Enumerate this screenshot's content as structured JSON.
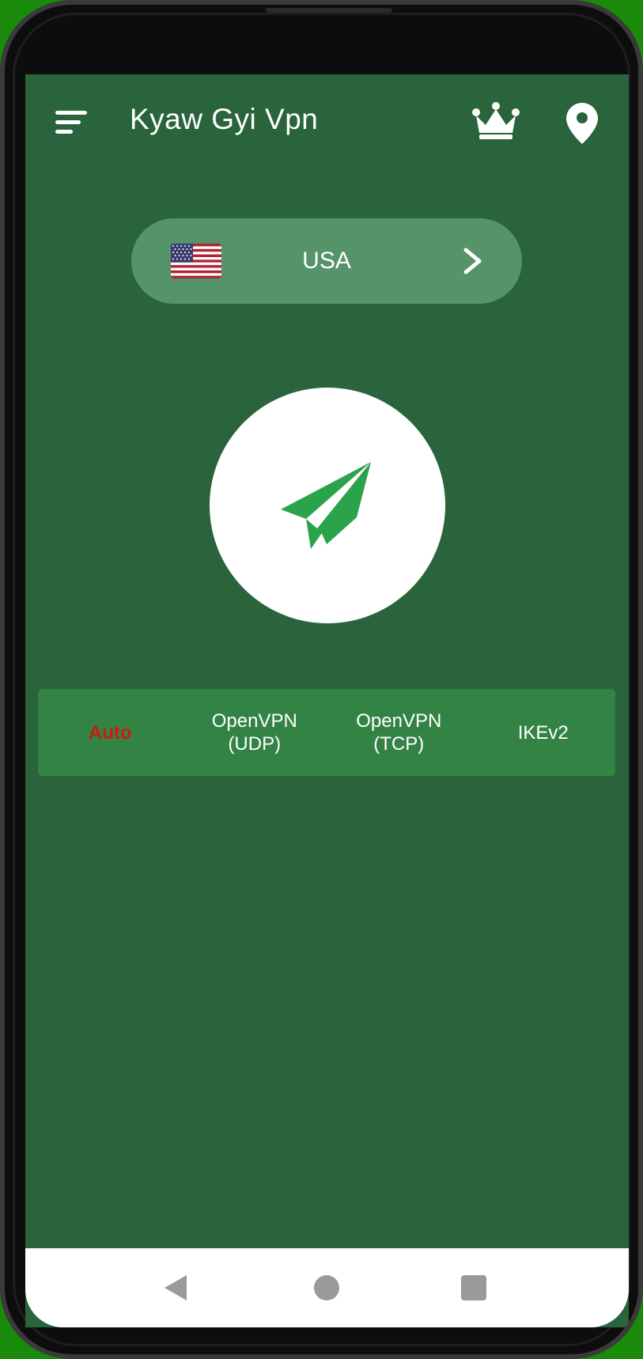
{
  "app": {
    "title": "Kyaw Gyi Vpn"
  },
  "header": {
    "menu_icon": "menu-icon",
    "premium_icon": "crown-icon",
    "location_icon": "location-pin-icon"
  },
  "server": {
    "country": "USA",
    "flag_icon": "us-flag-icon",
    "chevron_icon": "chevron-right-icon"
  },
  "connect": {
    "icon": "paper-plane-icon"
  },
  "protocols": [
    {
      "label": "Auto",
      "selected": true
    },
    {
      "label": "OpenVPN (UDP)",
      "selected": false
    },
    {
      "label": "OpenVPN (TCP)",
      "selected": false
    },
    {
      "label": "IKEv2",
      "selected": false
    }
  ],
  "navigation": {
    "back_icon": "back-triangle-icon",
    "home_icon": "home-circle-icon",
    "recents_icon": "recents-square-icon"
  },
  "colors": {
    "background": "#2a643d",
    "pill": "#559468",
    "protocol_bar": "#338345",
    "selected_protocol": "#cc1b12",
    "accent_green": "#2aa34a"
  }
}
